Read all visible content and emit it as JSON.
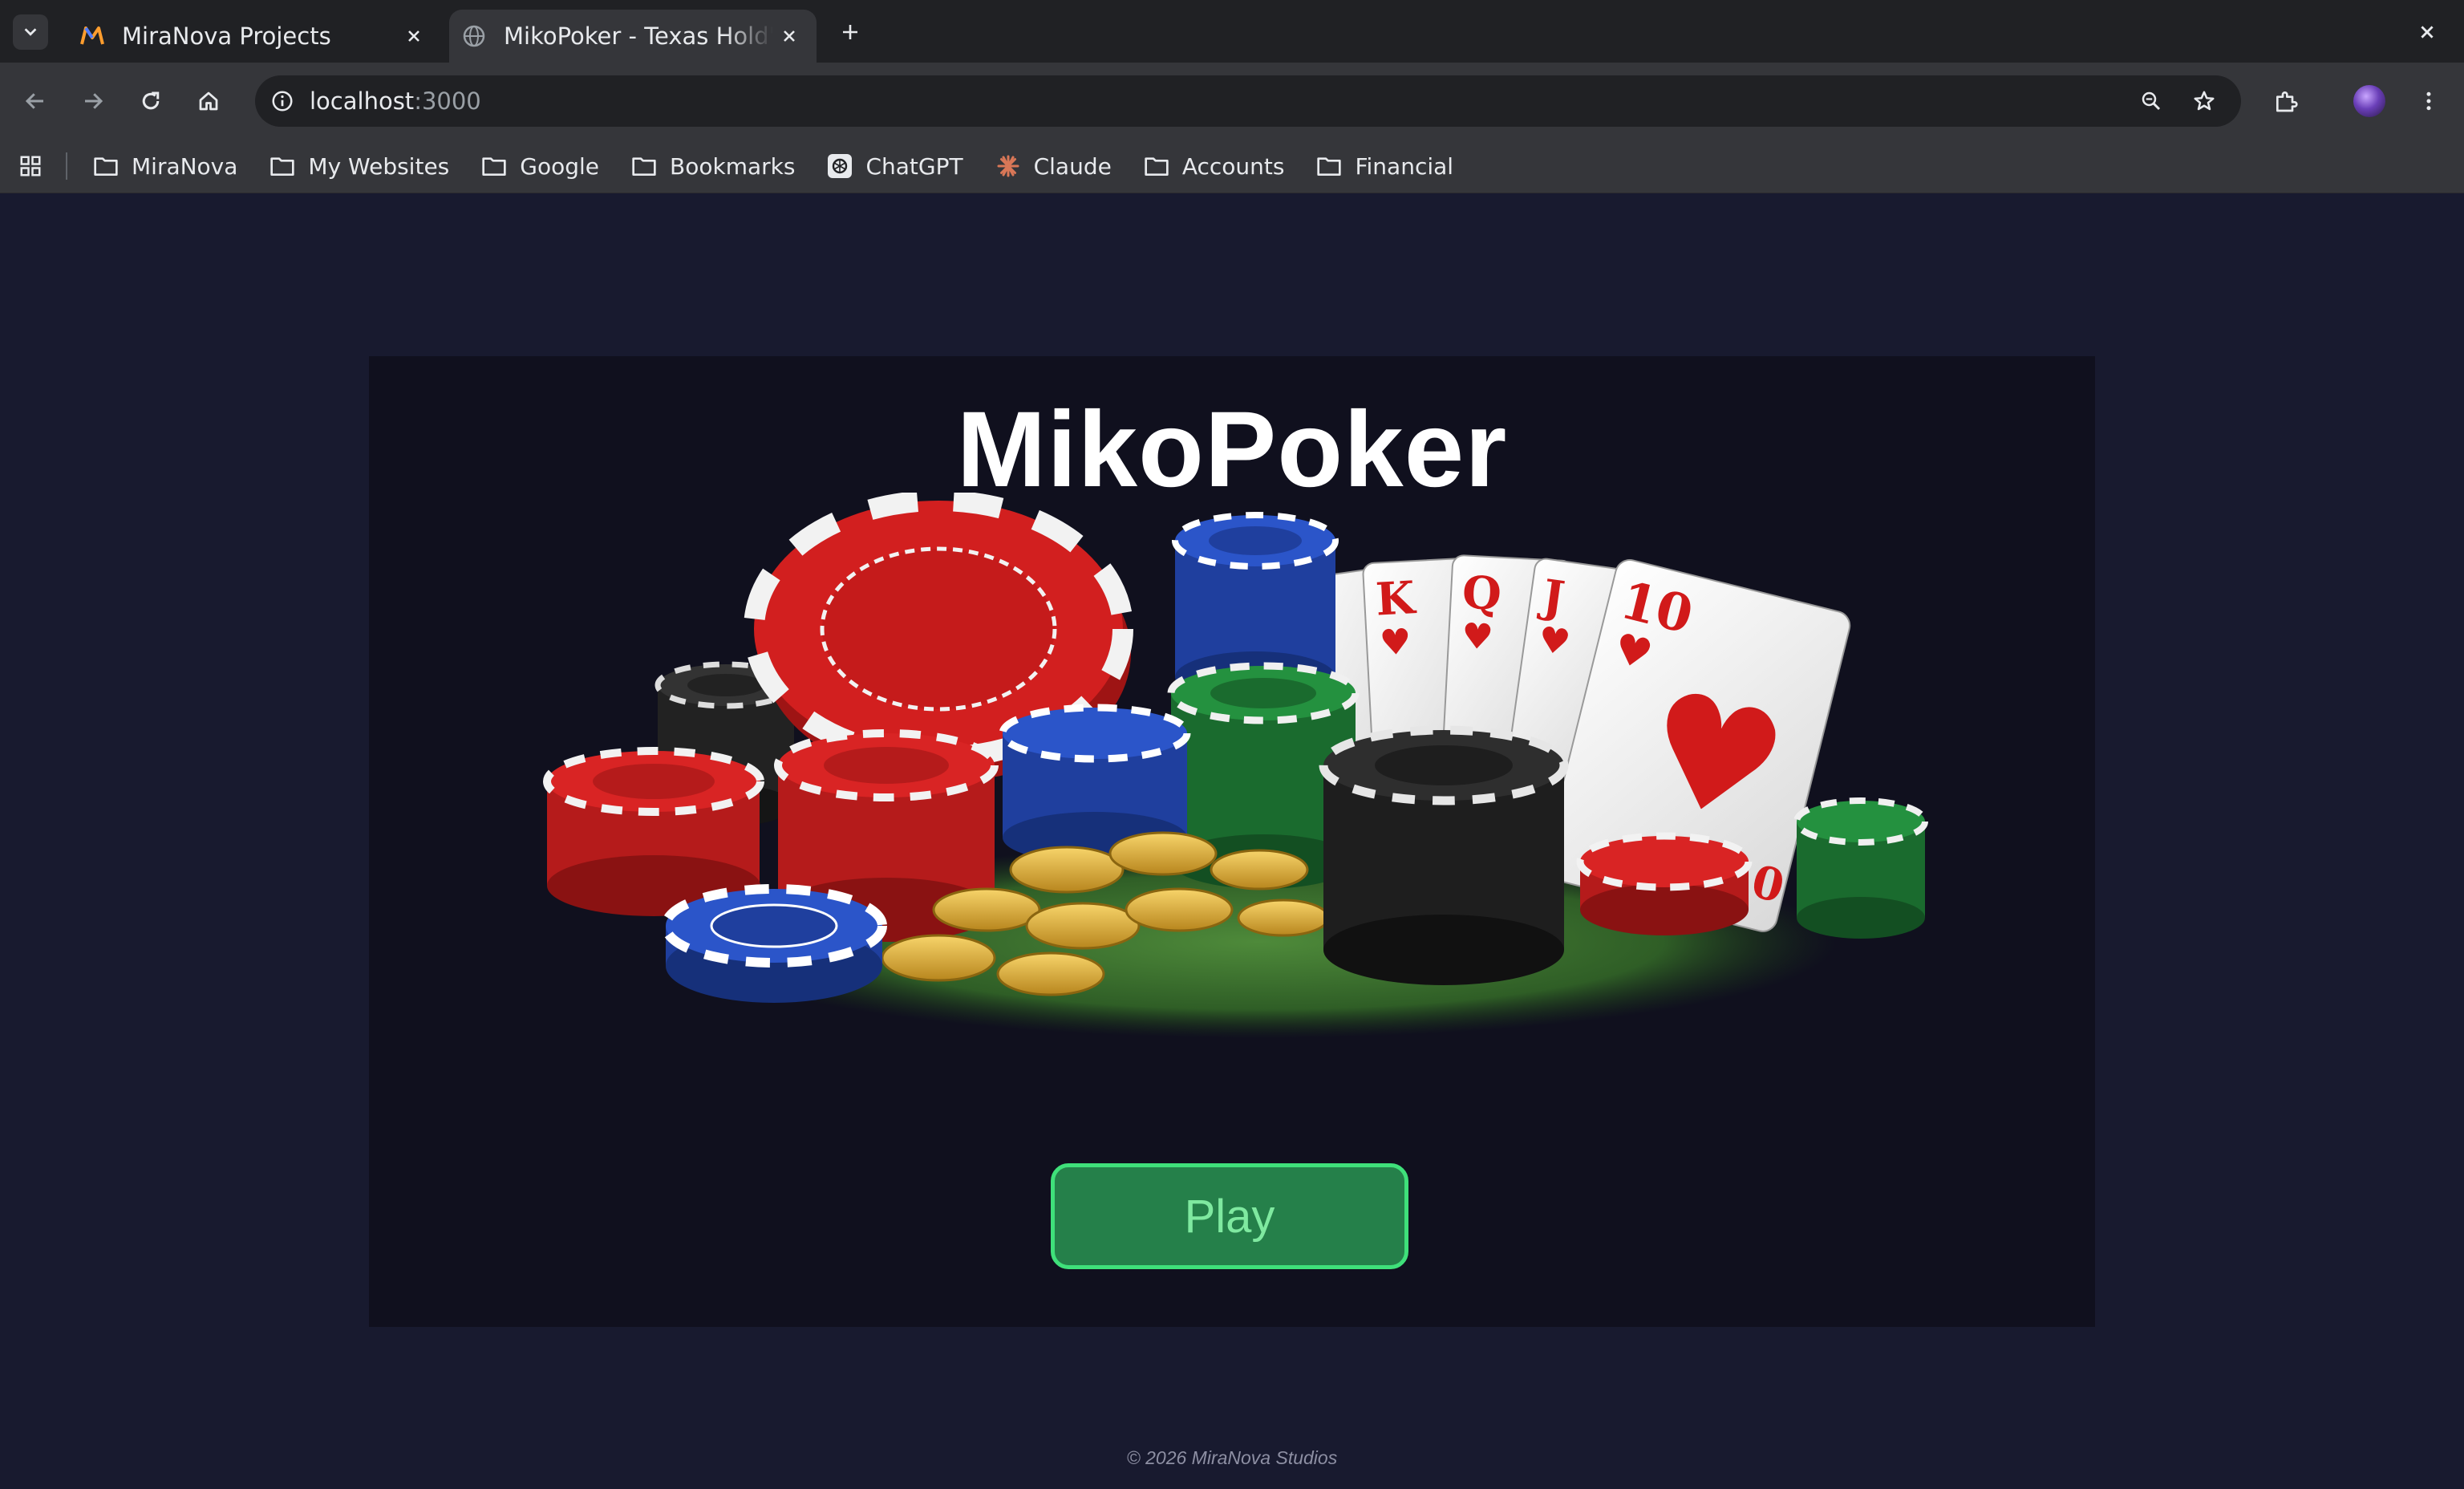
{
  "browser": {
    "tabs": [
      {
        "title": "MiraNova Projects",
        "favicon": "miranova-m-icon",
        "active": false
      },
      {
        "title": "MikoPoker - Texas Hold'em",
        "favicon": "globe-icon",
        "active": true
      }
    ],
    "address": {
      "host": "localhost",
      "port": ":3000"
    },
    "bookmarks": [
      {
        "label": "MiraNova",
        "icon": "folder-icon"
      },
      {
        "label": "My Websites",
        "icon": "folder-icon"
      },
      {
        "label": "Google",
        "icon": "folder-icon"
      },
      {
        "label": "Bookmarks",
        "icon": "folder-icon"
      },
      {
        "label": "ChatGPT",
        "icon": "chatgpt-icon"
      },
      {
        "label": "Claude",
        "icon": "claude-icon"
      },
      {
        "label": "Accounts",
        "icon": "folder-icon"
      },
      {
        "label": "Financial",
        "icon": "folder-icon"
      }
    ]
  },
  "page": {
    "title": "MikoPoker",
    "play_label": "Play",
    "footer": "© 2026 MiraNova Studios",
    "hero_image": "poker-chips-and-royal-flush-illustration"
  },
  "colors": {
    "page_bg": "#181a2f",
    "panel_bg": "#10101e",
    "play_bg": "#25804a",
    "play_border": "#3fe07a",
    "play_text": "#7fe9a0"
  }
}
